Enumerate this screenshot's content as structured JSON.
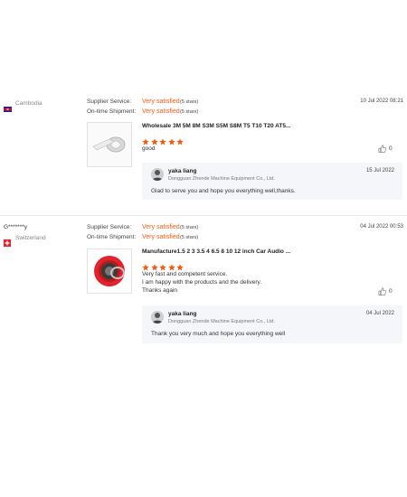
{
  "reviews": [
    {
      "buyer_name": "",
      "country": "Cambodia",
      "flag": "cambodia-flag-icon",
      "supplier_service_label": "Supplier Service:",
      "supplier_service_value": "Very satisfied",
      "supplier_service_stars": "(5 stars)",
      "shipment_label": "On-time Shipment:",
      "shipment_value": "Very satisfied",
      "shipment_stars": "(5 stars)",
      "date": "10 Jul 2022 08:21",
      "product_title": "Wholesale 3M 5M 8M S3M S5M S8M T5 T10 T20 AT5...",
      "rating": 5,
      "comment_lines": [
        "good"
      ],
      "likes": "0",
      "reply": {
        "name": "yaka liang",
        "company": "Dongguan Zhende Machine Equipment Co., Ltd.",
        "date": "15 Jul 2022",
        "text": "Glad to serve you and hope you everything well,thanks."
      }
    },
    {
      "buyer_name": "G*******y",
      "country": "Switzerland",
      "flag": "switzerland-flag-icon",
      "supplier_service_label": "Supplier Service:",
      "supplier_service_value": "Very satisfied",
      "supplier_service_stars": "(5 stars)",
      "shipment_label": "On-time Shipment:",
      "shipment_value": "Very satisfied",
      "shipment_stars": "(5 stars)",
      "date": "04 Jul 2022 00:53",
      "product_title": "Manufacture1.5 2 3 3.5 4 6.5 8 10 12 inch Car Audio ...",
      "rating": 5,
      "comment_lines": [
        "Very fast and competent service.",
        "I am happy with the products and the delivery.",
        "Thanks again"
      ],
      "likes": "0",
      "reply": {
        "name": "yaka liang",
        "company": "Dongguan Zhende Machine Equipment Co., Ltd.",
        "date": "04 Jul 2022",
        "text": "Thank you very much and hope you everything well"
      }
    }
  ],
  "colors": {
    "accent": "#f25b12",
    "reply_bg": "#f5f6f9",
    "divider": "#e6e6e6"
  }
}
